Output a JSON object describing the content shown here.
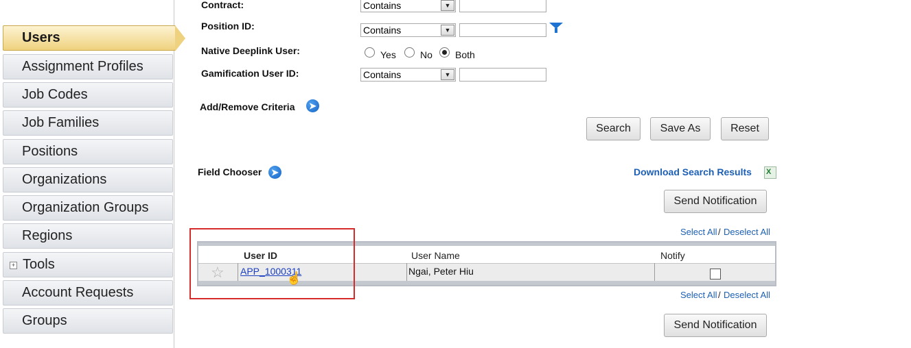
{
  "sidebar": {
    "items": [
      {
        "label": "Users"
      },
      {
        "label": "Assignment Profiles"
      },
      {
        "label": "Job Codes"
      },
      {
        "label": "Job Families"
      },
      {
        "label": "Positions"
      },
      {
        "label": "Organizations"
      },
      {
        "label": "Organization Groups"
      },
      {
        "label": "Regions"
      },
      {
        "label": "Tools"
      },
      {
        "label": "Account Requests"
      },
      {
        "label": "Groups"
      }
    ]
  },
  "form": {
    "contract": {
      "label": "Contract:",
      "operator": "Contains",
      "value": ""
    },
    "position_id": {
      "label": "Position ID:",
      "operator": "Contains",
      "value": ""
    },
    "native_deeplink": {
      "label": "Native Deeplink User:",
      "options": [
        "Yes",
        "No",
        "Both"
      ],
      "selected": "Both"
    },
    "gamification": {
      "label": "Gamification User ID:",
      "operator": "Contains",
      "value": ""
    },
    "add_remove_label": "Add/Remove Criteria",
    "field_chooser_label": "Field Chooser"
  },
  "buttons": {
    "search": "Search",
    "save_as": "Save As",
    "reset": "Reset",
    "send_notification": "Send Notification"
  },
  "download_label": "Download Search Results",
  "selection": {
    "select_all": "Select All",
    "separator": "/",
    "deselect_all": "Deselect All"
  },
  "table": {
    "headers": {
      "user_id": "User ID",
      "user_name": "User Name",
      "notify": "Notify"
    },
    "rows": [
      {
        "user_id": "APP_1000311",
        "user_name": "Ngai, Peter Hiu",
        "notify": false
      }
    ]
  },
  "colors": {
    "accent": "#1c5fb5",
    "active_nav": "#efd27f",
    "highlight": "#d42a2a"
  }
}
